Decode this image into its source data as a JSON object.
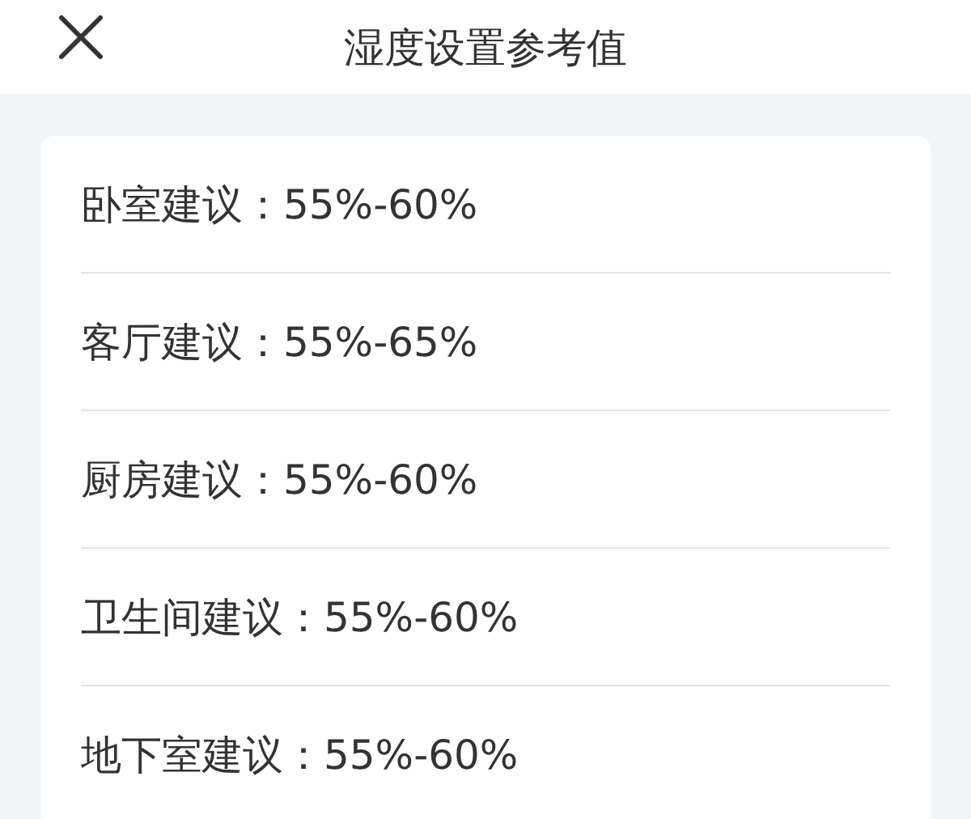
{
  "header": {
    "title": "湿度设置参考值"
  },
  "items": [
    {
      "text": "卧室建议：55%-60%"
    },
    {
      "text": "客厅建议：55%-65%"
    },
    {
      "text": "厨房建议：55%-60%"
    },
    {
      "text": "卫生间建议：55%-60%"
    },
    {
      "text": "地下室建议：55%-60%"
    }
  ]
}
